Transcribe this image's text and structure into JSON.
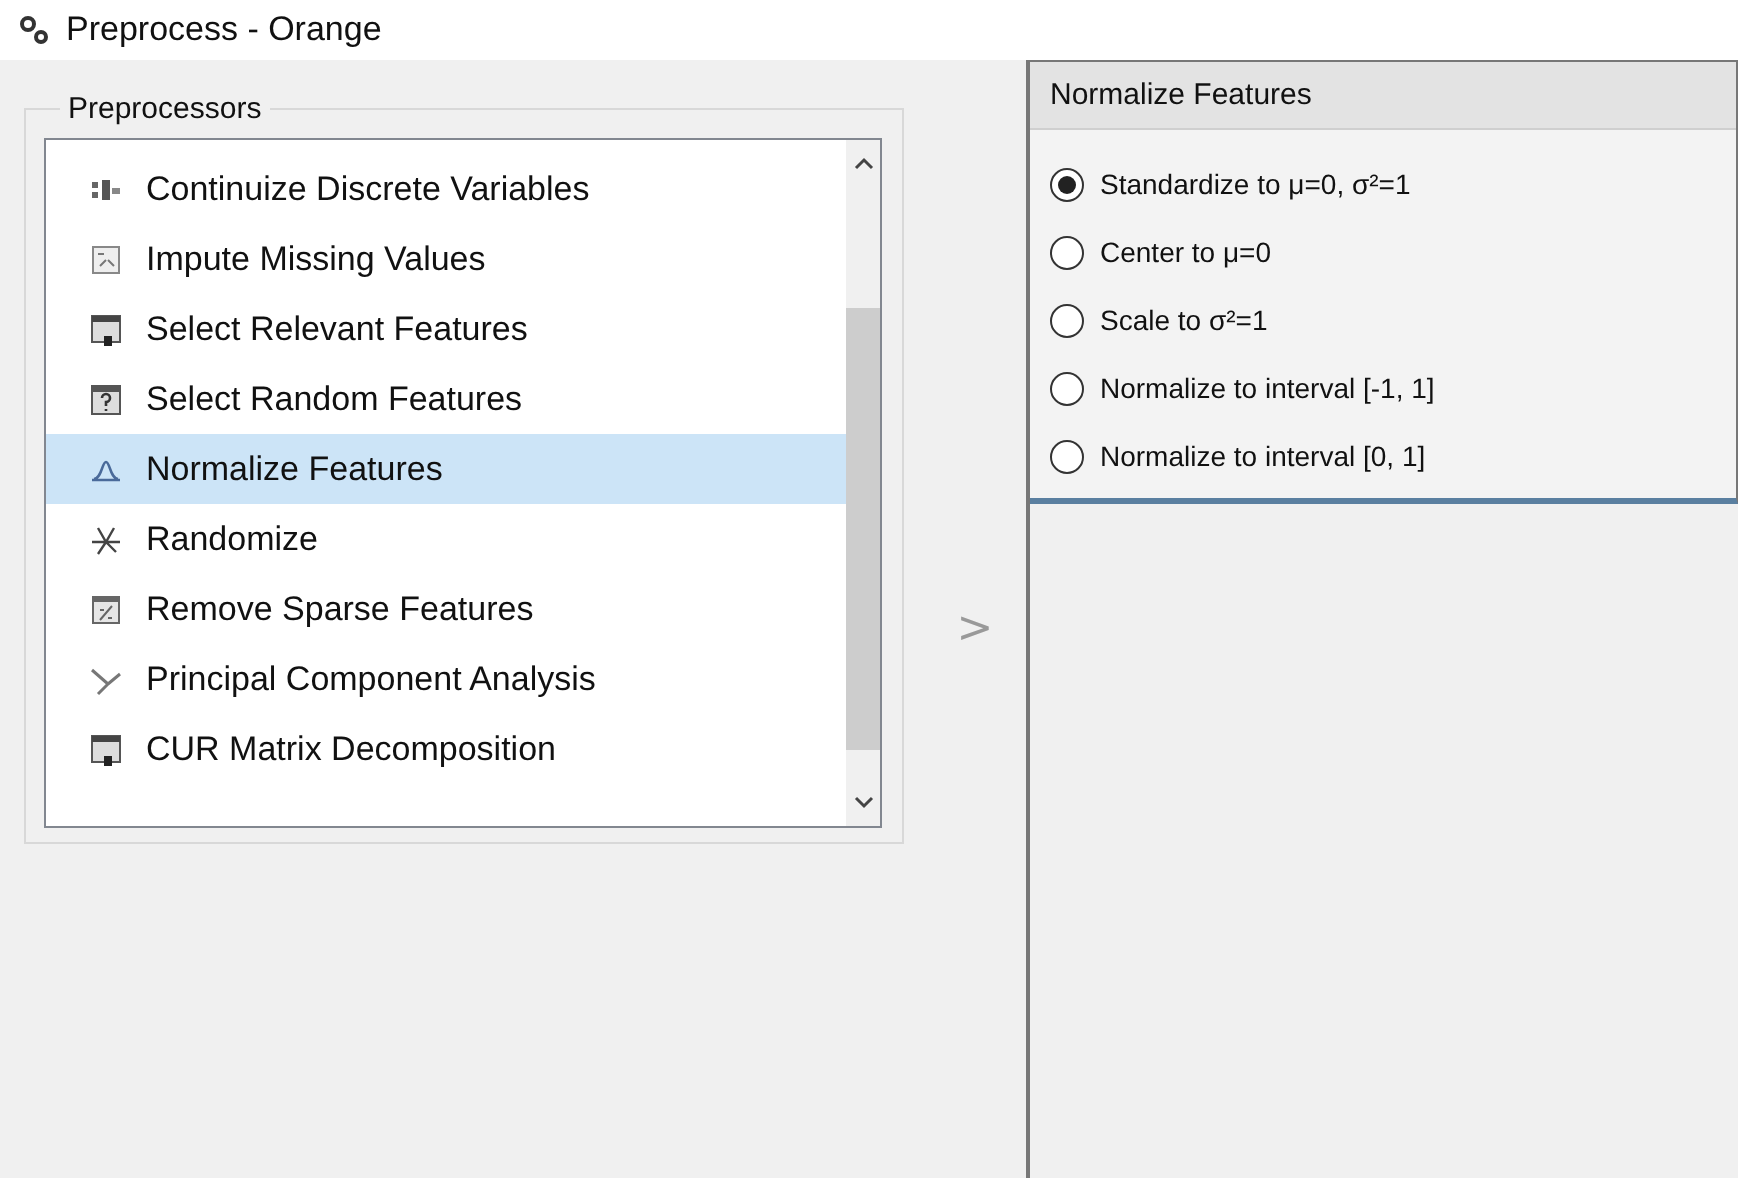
{
  "window": {
    "title": "Preprocess - Orange"
  },
  "preprocessors": {
    "title": "Preprocessors",
    "items": [
      {
        "label": "Continuize Discrete Variables",
        "selected": false
      },
      {
        "label": "Impute Missing Values",
        "selected": false
      },
      {
        "label": "Select Relevant Features",
        "selected": false
      },
      {
        "label": "Select Random Features",
        "selected": false
      },
      {
        "label": "Normalize Features",
        "selected": true
      },
      {
        "label": "Randomize",
        "selected": false
      },
      {
        "label": "Remove Sparse Features",
        "selected": false
      },
      {
        "label": "Principal Component Analysis",
        "selected": false
      },
      {
        "label": "CUR Matrix Decomposition",
        "selected": false
      }
    ]
  },
  "add_arrow": ">",
  "editor": {
    "title": "Normalize Features",
    "options": [
      {
        "label": "Standardize to μ=0, σ²=1",
        "selected": true
      },
      {
        "label": "Center to μ=0",
        "selected": false
      },
      {
        "label": "Scale to σ²=1",
        "selected": false
      },
      {
        "label": "Normalize to interval [-1, 1]",
        "selected": false
      },
      {
        "label": "Normalize to interval [0, 1]",
        "selected": false
      }
    ]
  }
}
